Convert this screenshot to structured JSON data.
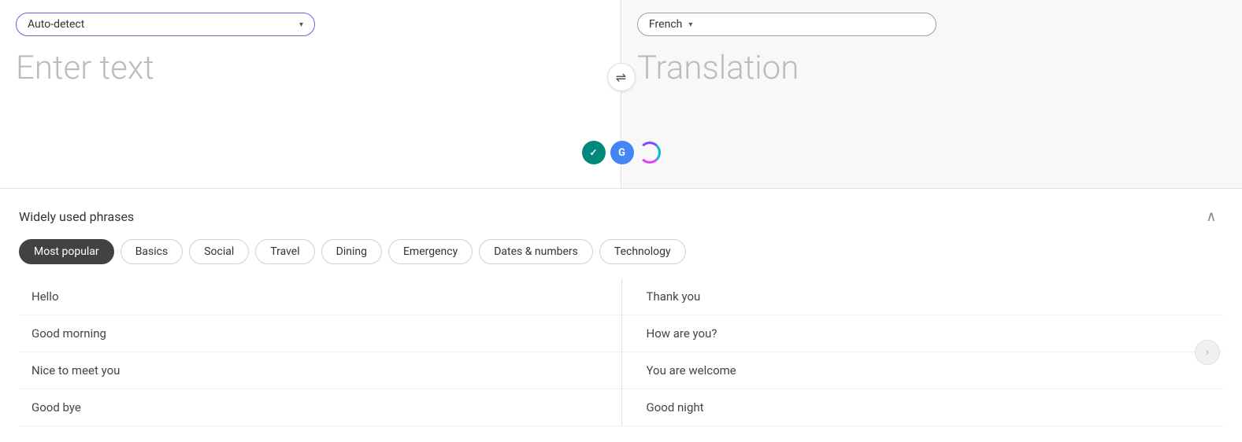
{
  "source": {
    "language": "Auto-detect",
    "placeholder": "Enter text",
    "dropdown_arrow": "▾"
  },
  "target": {
    "language": "French",
    "placeholder": "Translation",
    "dropdown_arrow": "▾"
  },
  "swap_button_symbol": "⇌",
  "icons": {
    "plugin1_letter": "✓",
    "plugin2_letter": "G"
  },
  "phrases": {
    "section_title": "Widely used phrases",
    "categories": [
      {
        "label": "Most popular",
        "active": true
      },
      {
        "label": "Basics"
      },
      {
        "label": "Social"
      },
      {
        "label": "Travel"
      },
      {
        "label": "Dining"
      },
      {
        "label": "Emergency"
      },
      {
        "label": "Dates & numbers"
      },
      {
        "label": "Technology"
      }
    ],
    "items_left": [
      {
        "text": "Hello"
      },
      {
        "text": "Good morning"
      },
      {
        "text": "Nice to meet you"
      },
      {
        "text": "Good bye"
      }
    ],
    "items_right": [
      {
        "text": "Thank you"
      },
      {
        "text": "How are you?"
      },
      {
        "text": "You are welcome"
      },
      {
        "text": "Good night"
      }
    ]
  }
}
